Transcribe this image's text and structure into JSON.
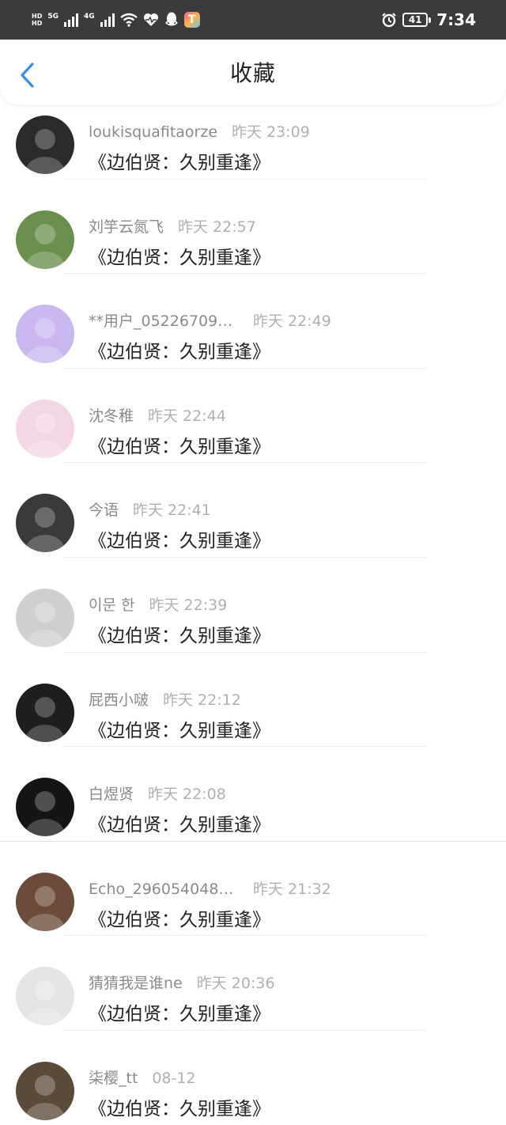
{
  "status_bar": {
    "hd1": "HD",
    "hd2": "HD",
    "net1": "5G",
    "net2": "4G",
    "battery": "41",
    "time": "7:34"
  },
  "navbar": {
    "title": "收藏"
  },
  "items": [
    {
      "name": "loukisquafitaorze",
      "time": "昨天 23:09",
      "content": "《边伯贤：久别重逢》",
      "avatar_color": "#2b2b2b"
    },
    {
      "name": "刘竽云氮飞",
      "time": "昨天 22:57",
      "content": "《边伯贤：久别重逢》",
      "avatar_color": "#6b8f4e"
    },
    {
      "name": "**用户_052267097...",
      "time": "昨天 22:49",
      "content": "《边伯贤：久别重逢》",
      "avatar_color": "#c9b8f0"
    },
    {
      "name": "沈冬稚",
      "time": "昨天 22:44",
      "content": "《边伯贤：久别重逢》",
      "avatar_color": "#f3d6e4"
    },
    {
      "name": "今语",
      "time": "昨天 22:41",
      "content": "《边伯贤：久别重逢》",
      "avatar_color": "#3a3a3a"
    },
    {
      "name": "이문 한",
      "time": "昨天 22:39",
      "content": "《边伯贤：久别重逢》",
      "avatar_color": "#cfcfcf"
    },
    {
      "name": "屁西小啵",
      "time": "昨天 22:12",
      "content": "《边伯贤：久别重逢》",
      "avatar_color": "#1e1e1e"
    },
    {
      "name": "白煜贤",
      "time": "昨天 22:08",
      "content": "《边伯贤：久别重逢》",
      "avatar_color": "#151515"
    },
    {
      "name": "Echo_2960540486...",
      "time": "昨天 21:32",
      "content": "《边伯贤：久别重逢》",
      "avatar_color": "#6b4b3a"
    },
    {
      "name": "猜猜我是谁ne",
      "time": "昨天 20:36",
      "content": "《边伯贤：久别重逢》",
      "avatar_color": "#e4e4e4"
    },
    {
      "name": "柒樱_tt",
      "time": "08-12",
      "content": "《边伯贤：久别重逢》",
      "avatar_color": "#5a4a3a"
    }
  ],
  "colors": {
    "status_bar": "#3b3b3b",
    "back_arrow": "#3a8ee6",
    "title": "#222222",
    "name": "#8a8a8a",
    "time": "#b0b0b0"
  }
}
